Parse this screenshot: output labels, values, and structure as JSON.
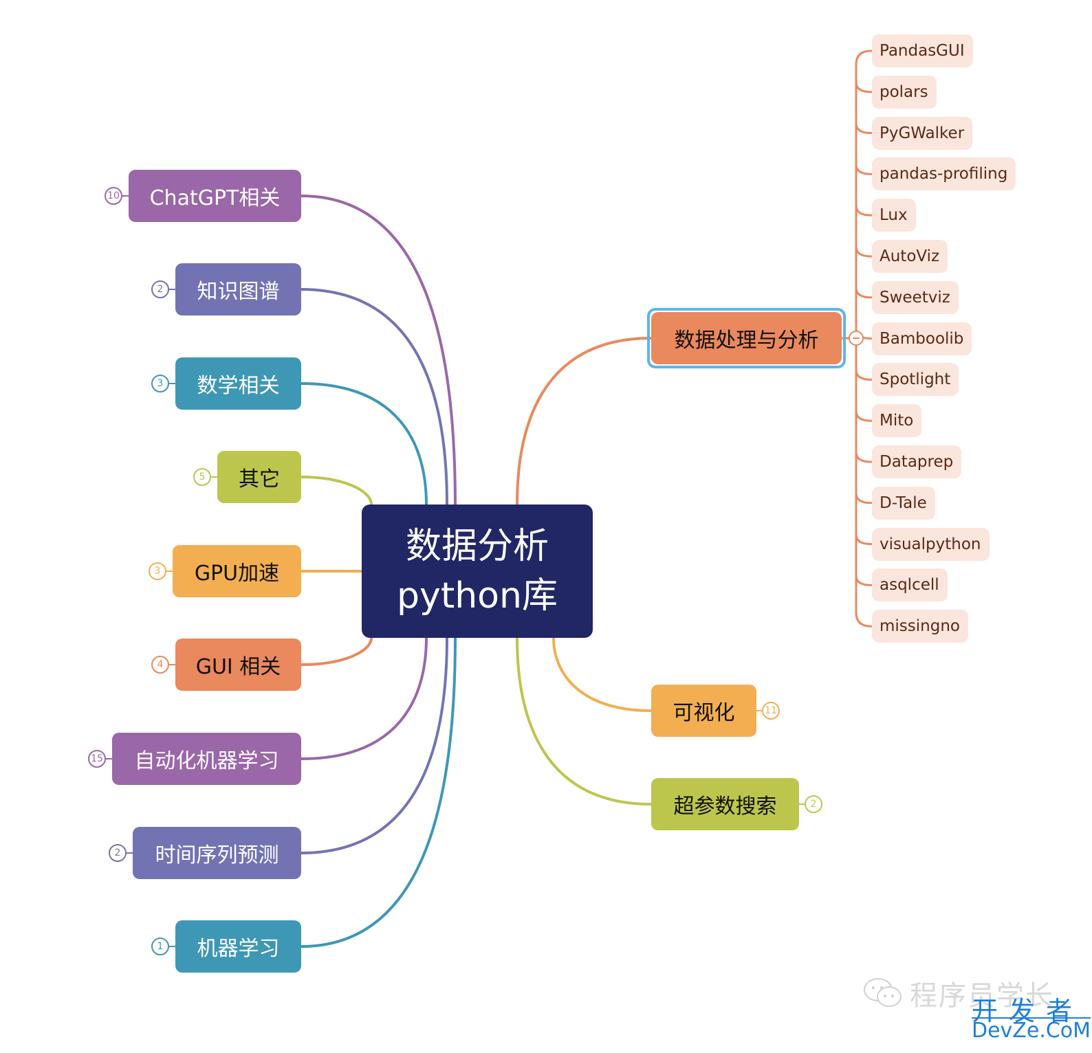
{
  "mindmap": {
    "root": {
      "line1": "数据分析",
      "line2": "python库",
      "color": "#212765"
    },
    "left_branches": [
      {
        "label": "ChatGPT相关",
        "count": "10",
        "color": "#9a67a8",
        "text_theme": "light"
      },
      {
        "label": "知识图谱",
        "count": "2",
        "color": "#7373b3",
        "text_theme": "light"
      },
      {
        "label": "数学相关",
        "count": "3",
        "color": "#3f97b6",
        "text_theme": "light"
      },
      {
        "label": "其它",
        "count": "5",
        "color": "#bcc64c",
        "text_theme": "dark"
      },
      {
        "label": "GPU加速",
        "count": "3",
        "color": "#f2ae50",
        "text_theme": "dark"
      },
      {
        "label": "GUI 相关",
        "count": "4",
        "color": "#ea885e",
        "text_theme": "dark"
      },
      {
        "label": "自动化机器学习",
        "count": "15",
        "color": "#9a67a8",
        "text_theme": "light"
      },
      {
        "label": "时间序列预测",
        "count": "2",
        "color": "#7373b3",
        "text_theme": "light"
      },
      {
        "label": "机器学习",
        "count": "1",
        "color": "#3f97b6",
        "text_theme": "light"
      }
    ],
    "right_branches": [
      {
        "label": "数据处理与分析",
        "color": "#ea885e",
        "text_theme": "dark",
        "selected": true,
        "expanded": true,
        "children": [
          "PandasGUI",
          "polars",
          "PyGWalker",
          "pandas-profiling",
          "Lux",
          "AutoViz",
          "Sweetviz",
          "Bamboolib",
          "Spotlight",
          "Mito",
          "Dataprep",
          "D-Tale",
          "visualpython",
          "asqlcell",
          "missingno"
        ]
      },
      {
        "label": "可视化",
        "count": "11",
        "color": "#f2ae50",
        "text_theme": "dark"
      },
      {
        "label": "超参数搜索",
        "count": "2",
        "color": "#bcc64c",
        "text_theme": "dark"
      }
    ],
    "selection_color": "#5bb6ee",
    "leaf_bg": "#fbe6dd",
    "leaf_text": "#5a2a15"
  },
  "watermark": {
    "account": "程序员学长",
    "site_cn": "开发者",
    "site_en": "DevZe.CoM"
  }
}
